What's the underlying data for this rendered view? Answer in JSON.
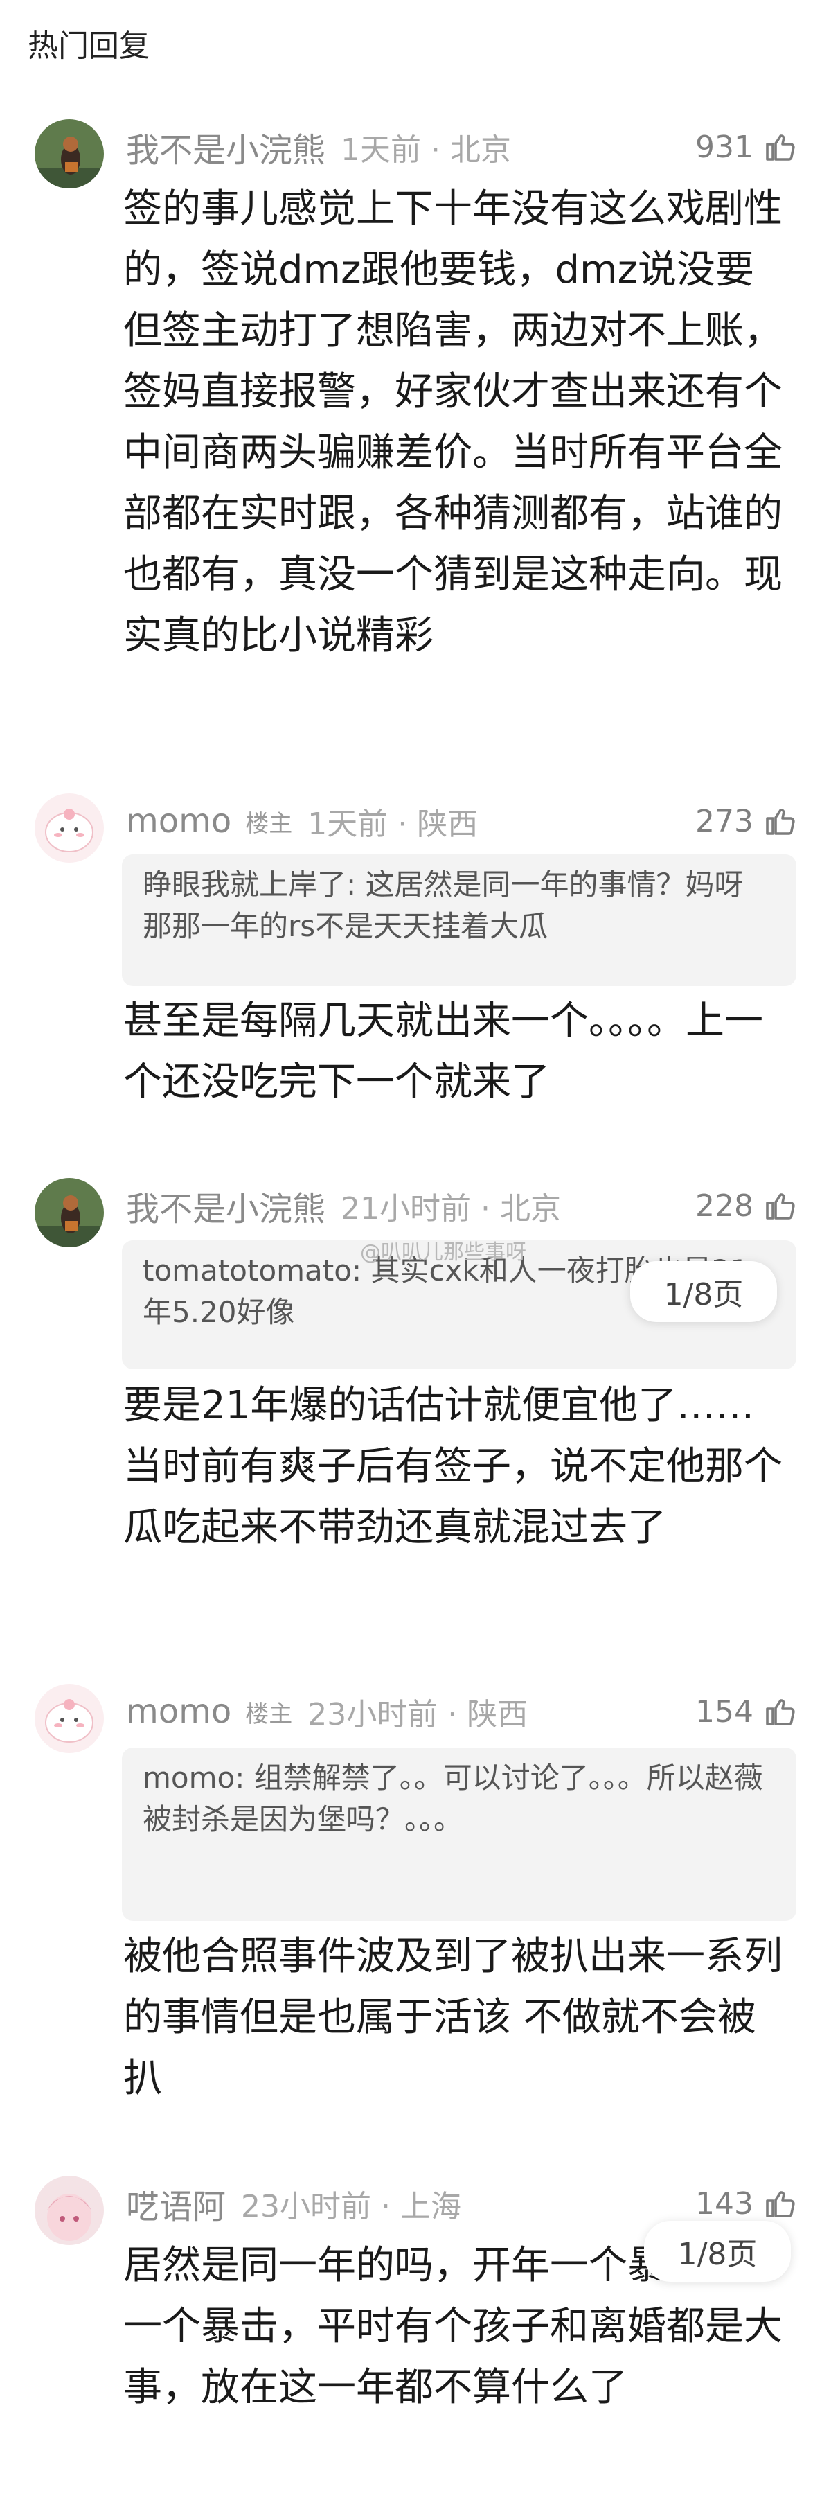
{
  "header": {
    "title": "热门回复"
  },
  "comments": [
    {
      "name": "我不是小浣熊",
      "badge": "",
      "time": "1天前 · 北京",
      "likes": "931",
      "quote": "",
      "body": "签的事儿感觉上下十年没有这么戏剧性的，签说dmz跟他要钱，dmz说没要但签主动打了想陷害，两边对不上账，签妈直接报警，好家伙才查出来还有个中间商两头骗赚差价。当时所有平台全部都在实时跟，各种猜测都有，站谁的也都有，真没一个猜到是这种走向。现实真的比小说精彩"
    },
    {
      "name": "momo",
      "badge": "楼主",
      "time": "1天前 · 陕西",
      "likes": "273",
      "quote": "睁眼我就上岸了: 这居然是同一年的事情？妈呀 那那一年的rs不是天天挂着大瓜",
      "body": "甚至是每隔几天就出来一个。。。。上一个还没吃完下一个就来了"
    },
    {
      "name": "我不是小浣熊",
      "badge": "",
      "time": "21小时前 · 北京",
      "likes": "228",
      "quote": "tomatotomato: 其实cxk和人一夜打胎也是21年5.20好像",
      "body": "要是21年爆的话估计就便宜他了……当时前有爽子后有签子，说不定他那个瓜吃起来不带劲还真就混过去了"
    },
    {
      "name": "momo",
      "badge": "楼主",
      "time": "23小时前 · 陕西",
      "likes": "154",
      "quote": "momo: 组禁解禁了。。可以讨论了。。。所以赵薇被封杀是因为堡吗？。。。",
      "body": "被他合照事件波及到了被扒出来一系列的事情但是也属于活该 不做就不会被扒"
    },
    {
      "name": "呓语阿",
      "badge": "",
      "time": "23小时前 · 上海",
      "likes": "143",
      "quote": "",
      "body": "居然是同一年的吗，开年一个暴击年中一个暴击，平时有个孩子和离婚都是大事，放在这一年都不算什么了"
    }
  ],
  "watermark": "@叭叭儿那些事呀",
  "pager": {
    "label": "1/8页"
  },
  "colors": {
    "background": "#ffffff",
    "meta": "#8a8a8a",
    "quote_bg": "#f3f3f3",
    "pager_accent": "#2e9b7a"
  }
}
